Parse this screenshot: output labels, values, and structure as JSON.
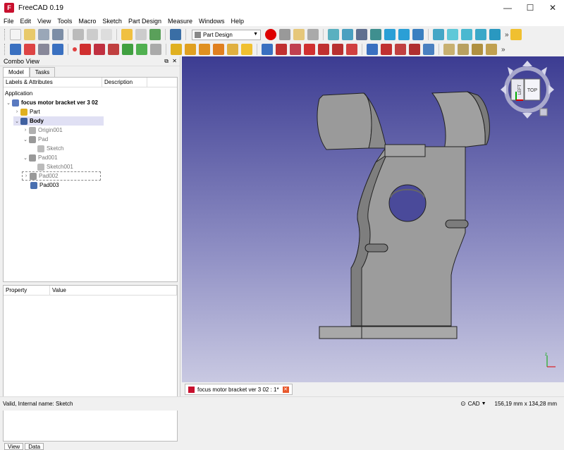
{
  "window": {
    "title": "FreeCAD 0.19",
    "app_icon": "freecad-logo-icon"
  },
  "menu": [
    "File",
    "Edit",
    "View",
    "Tools",
    "Macro",
    "Sketch",
    "Part Design",
    "Measure",
    "Windows",
    "Help"
  ],
  "toolbar": {
    "workbench": "Part Design",
    "more": "»"
  },
  "combo": {
    "title": "Combo View",
    "tabs": [
      "Model",
      "Tasks"
    ],
    "tree_headers": [
      "Labels & Attributes",
      "Description"
    ],
    "section": "Application",
    "items": [
      {
        "label": "focus motor bracket ver 3 02",
        "icon": "document-icon"
      },
      {
        "label": "Part",
        "icon": "part-icon"
      },
      {
        "label": "Body",
        "icon": "body-icon"
      },
      {
        "label": "Origin001",
        "icon": "origin-icon"
      },
      {
        "label": "Pad",
        "icon": "pad-icon"
      },
      {
        "label": "Sketch",
        "icon": "sketch-icon"
      },
      {
        "label": "Pad001",
        "icon": "pad-icon"
      },
      {
        "label": "Sketch001",
        "icon": "sketch-icon"
      },
      {
        "label": "Pad002",
        "icon": "pad-icon"
      },
      {
        "label": "Pad003",
        "icon": "pad-icon"
      }
    ],
    "prop_headers": [
      "Property",
      "Value"
    ],
    "bottom_tabs": [
      "View",
      "Data"
    ]
  },
  "nav_cube": {
    "left": "LEFT",
    "top": "TOP"
  },
  "doc_tab": "focus motor bracket ver 3 02 : 1*",
  "status": {
    "message": "Valid, Internal name: Sketch",
    "nav_style": "CAD",
    "dimensions": "156,19 mm x 134,28 mm"
  }
}
